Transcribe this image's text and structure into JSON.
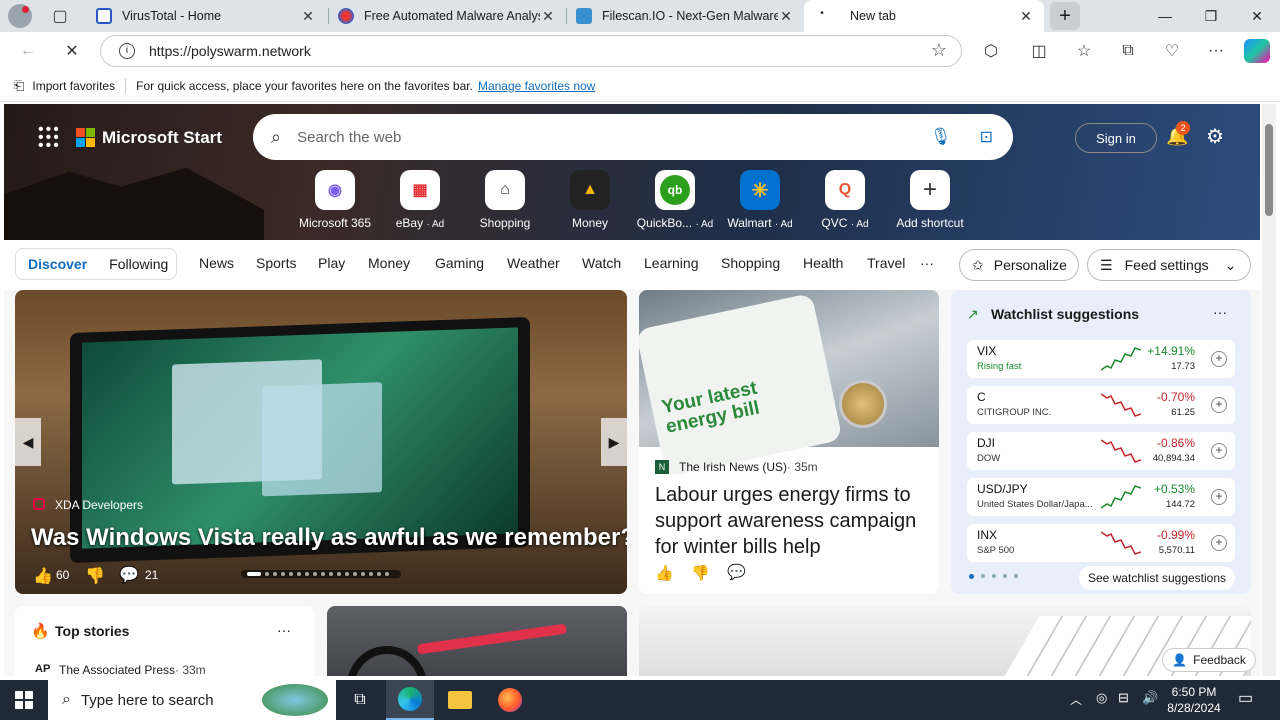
{
  "tabs": [
    {
      "title": "VirusTotal - Home",
      "close": "✕"
    },
    {
      "title": "Free Automated Malware Analysis",
      "close": "✕"
    },
    {
      "title": "Filescan.IO - Next-Gen Malware Analysis",
      "close": "✕"
    },
    {
      "title": "New tab",
      "close": "✕"
    }
  ],
  "address": {
    "url": "https://polyswarm.network"
  },
  "favbar": {
    "import": "Import favorites",
    "hint": "For quick access, place your favorites here on the favorites bar.",
    "manage": "Manage favorites now"
  },
  "header": {
    "brand": "Microsoft Start",
    "search_placeholder": "Search the web",
    "signin": "Sign in",
    "notif_count": "2"
  },
  "shortcuts": [
    {
      "label": "Microsoft 365",
      "ad": ""
    },
    {
      "label": "eBay",
      "ad": "· Ad"
    },
    {
      "label": "Shopping",
      "ad": ""
    },
    {
      "label": "Money",
      "ad": ""
    },
    {
      "label": "QuickBo...",
      "ad": "· Ad"
    },
    {
      "label": "Walmart",
      "ad": "· Ad"
    },
    {
      "label": "QVC",
      "ad": "· Ad"
    },
    {
      "label": "Add shortcut",
      "ad": ""
    }
  ],
  "nav": {
    "discover": "Discover",
    "following": "Following",
    "items": [
      "News",
      "Sports",
      "Play",
      "Money",
      "Gaming",
      "Weather",
      "Watch",
      "Learning",
      "Shopping",
      "Health",
      "Travel"
    ],
    "more": "···",
    "personalize": "Personalize",
    "feed_settings": "Feed settings"
  },
  "hero_card": {
    "source": "XDA Developers",
    "headline": "Was Windows Vista really as awful as we remember?",
    "likes": "60",
    "comments": "21"
  },
  "news_card": {
    "source": "The Irish News (US)",
    "age": "· 35m",
    "headline": "Labour urges energy firms to support awareness campaign for winter bills help",
    "image_text": "Your latest energy bill"
  },
  "watchlist": {
    "title": "Watchlist suggestions",
    "more": "···",
    "see_all": "See watchlist suggestions",
    "stocks": [
      {
        "sym": "VIX",
        "sub": "Rising fast",
        "chg": "+14.91%",
        "px": "17.73",
        "dir": "up"
      },
      {
        "sym": "C",
        "sub": "CITIGROUP INC.",
        "chg": "-0.70%",
        "px": "61.25",
        "dir": "down"
      },
      {
        "sym": "DJI",
        "sub": "DOW",
        "chg": "-0.86%",
        "px": "40,894.34",
        "dir": "down"
      },
      {
        "sym": "USD/JPY",
        "sub": "United States Dollar/Japa...",
        "chg": "+0.53%",
        "px": "144.72",
        "dir": "up"
      },
      {
        "sym": "INX",
        "sub": "S&P 500",
        "chg": "-0.99%",
        "px": "5,570.11",
        "dir": "down"
      }
    ]
  },
  "top_stories": {
    "title": "Top stories",
    "more": "···",
    "source_logo": "AP",
    "source": "The Associated Press",
    "age": "· 33m"
  },
  "feedback": "Feedback",
  "taskbar": {
    "search_placeholder": "Type here to search",
    "time": "6:50 PM",
    "date": "8/28/2024"
  },
  "colors": {
    "up": "#1a8a2c",
    "down": "#c4262e",
    "accent": "#0f6cbd"
  }
}
